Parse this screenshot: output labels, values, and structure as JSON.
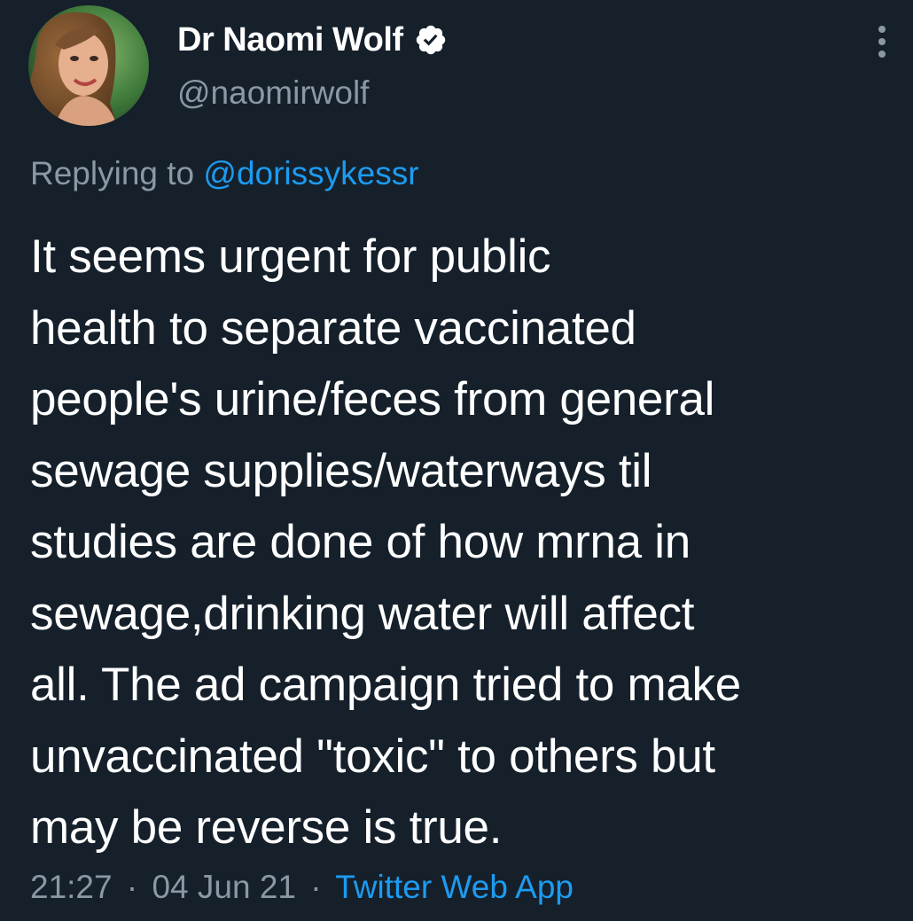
{
  "author": {
    "display_name": "Dr Naomi Wolf",
    "handle": "@naomirwolf",
    "verified_icon": "verified-badge-icon",
    "avatar_icon": "profile-photo"
  },
  "menu": {
    "icon": "more-vertical-icon"
  },
  "reply": {
    "prefix": "Replying to",
    "mention": "@dorissykessr"
  },
  "tweet": {
    "lines": [
      "It seems urgent for public",
      "health to separate vaccinated",
      "people's urine/feces from general",
      "sewage supplies/waterways til",
      "studies are done of how mrna in",
      "sewage,drinking water will affect",
      "all. The ad campaign tried to make",
      "unvaccinated \"toxic\" to others but",
      "may be reverse is true."
    ]
  },
  "meta": {
    "time": "21:27",
    "date": "04 Jun 21",
    "separator": "·",
    "source": "Twitter Web App"
  },
  "colors": {
    "background": "#15202b",
    "text": "#ffffff",
    "secondary": "#8b98a5",
    "accent": "#1d9bf0"
  }
}
